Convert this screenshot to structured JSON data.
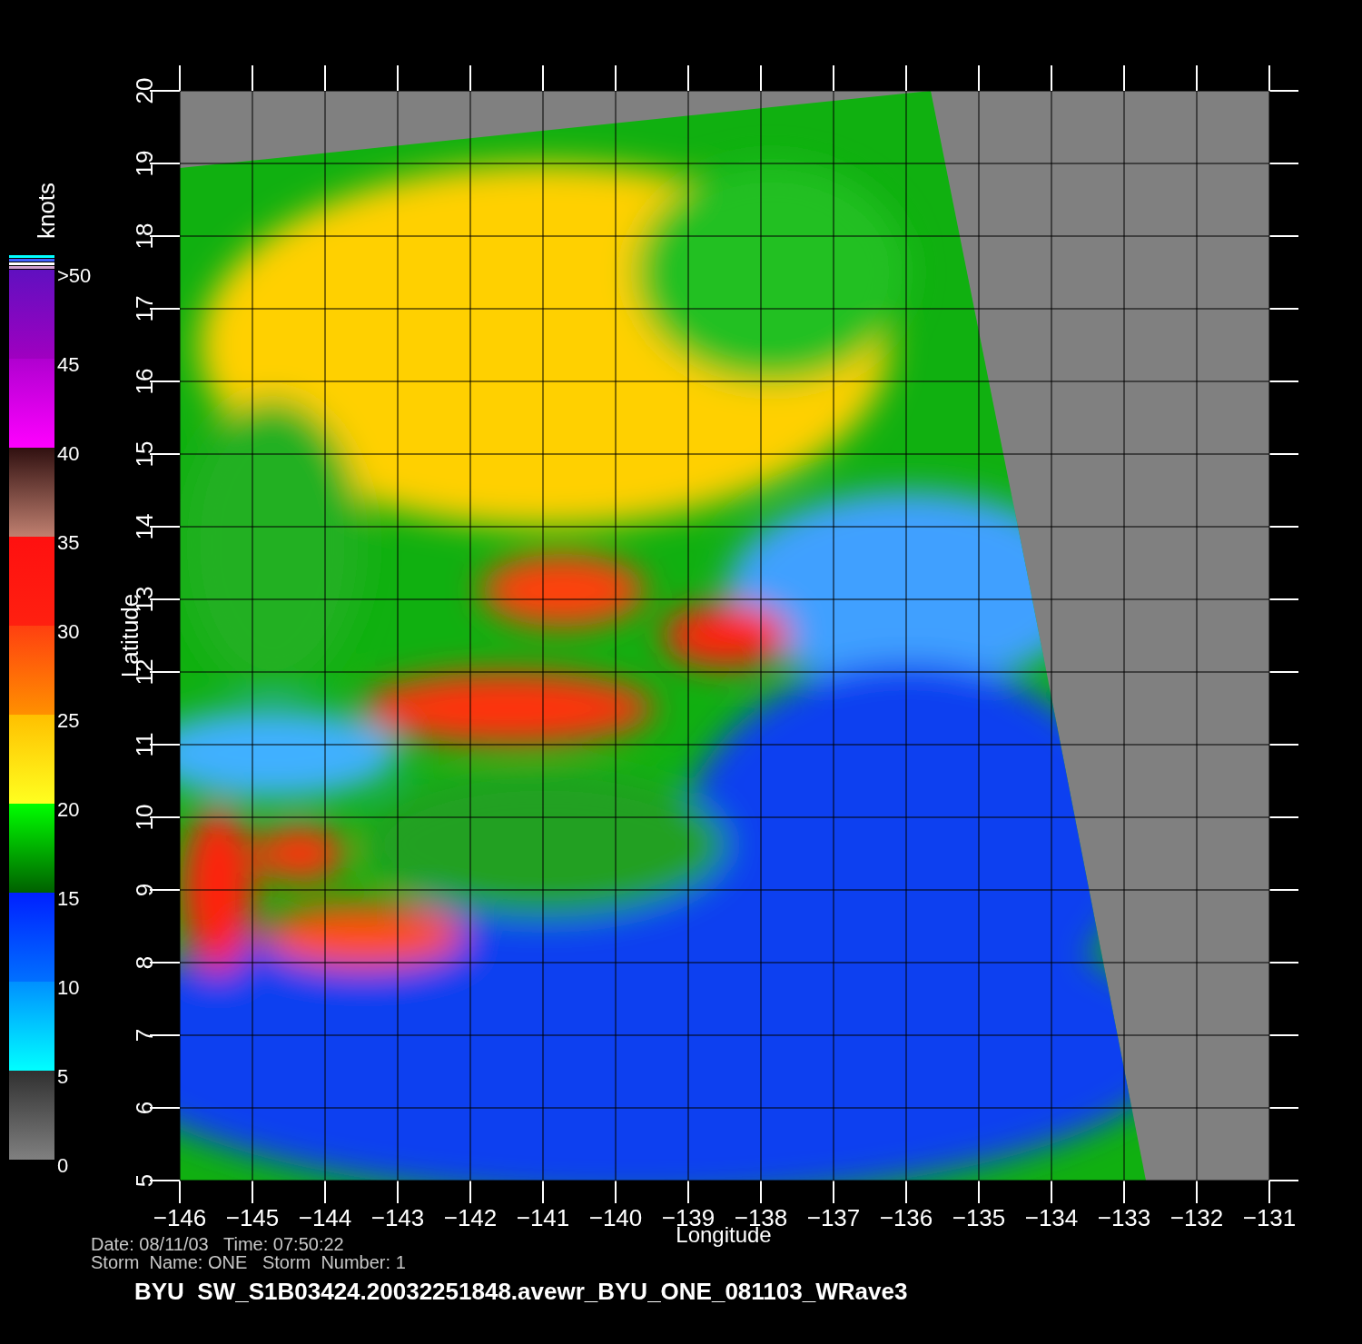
{
  "colorbar": {
    "unit": "knots",
    "labels": [
      ">50",
      "45",
      "40",
      "35",
      "30",
      "25",
      "20",
      "15",
      "10",
      "5",
      "0"
    ]
  },
  "map": {
    "ylabel": "Latitude",
    "xlabel": "Longitude",
    "yticks": [
      "20",
      "19",
      "18",
      "17",
      "16",
      "15",
      "14",
      "13",
      "12",
      "11",
      "10",
      "9",
      "8",
      "7",
      "6",
      "5"
    ],
    "xticks": [
      "−146",
      "−145",
      "−144",
      "−143",
      "−142",
      "−141",
      "−140",
      "−139",
      "−138",
      "−137",
      "−136",
      "−135",
      "−134",
      "−133",
      "−132",
      "−131"
    ]
  },
  "info": {
    "date_label": "Date:",
    "date": "08/11/03",
    "time_label": "Time:",
    "time": "07:50:22",
    "storm_name_label": "Storm  Name:",
    "storm_name": "ONE",
    "storm_number_label": "Storm  Number:",
    "storm_number": "1"
  },
  "filename": "BYU  SW_S1B03424.20032251848.avewr_BYU_ONE_081103_WRave3"
}
